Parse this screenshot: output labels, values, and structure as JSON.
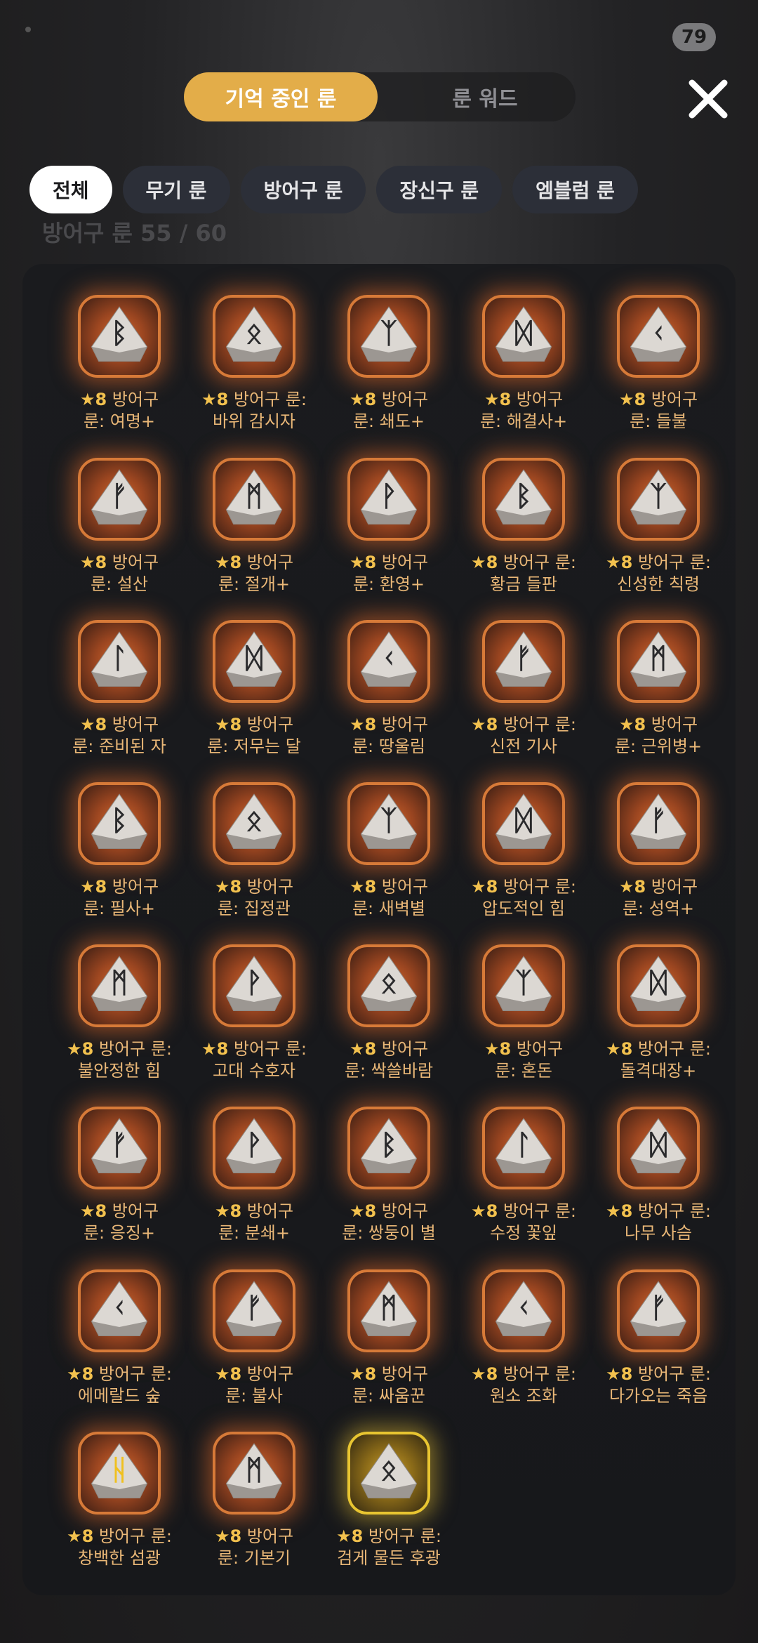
{
  "status": {
    "badge": "79"
  },
  "tabs": {
    "active": "기억 중인 룬",
    "inactive": "룬 워드"
  },
  "filters": [
    "전체",
    "무기 룬",
    "방어구 룬",
    "장신구 룬",
    "엠블럼 룬"
  ],
  "ghost_text": "방어구 룬 55 / 60",
  "star_prefix": "★8",
  "runes": [
    {
      "l1": "방어구",
      "l2": "룬: 여명+",
      "glyph": "ᛒ"
    },
    {
      "l1": "방어구 룬:",
      "l2": "바위 감시자",
      "glyph": "ᛟ"
    },
    {
      "l1": "방어구",
      "l2": "룬: 쇄도+",
      "glyph": "ᛉ"
    },
    {
      "l1": "방어구",
      "l2": "룬: 해결사+",
      "glyph": "ᛞ"
    },
    {
      "l1": "방어구",
      "l2": "룬: 들불",
      "glyph": "ᚲ"
    },
    {
      "l1": "방어구",
      "l2": "룬: 설산",
      "glyph": "ᚠ"
    },
    {
      "l1": "방어구",
      "l2": "룬: 절개+",
      "glyph": "ᛗ"
    },
    {
      "l1": "방어구",
      "l2": "룬: 환영+",
      "glyph": "ᚹ"
    },
    {
      "l1": "방어구 룬:",
      "l2": "황금 들판",
      "glyph": "ᛒ"
    },
    {
      "l1": "방어구 룬:",
      "l2": "신성한 칙령",
      "glyph": "ᛉ"
    },
    {
      "l1": "방어구",
      "l2": "룬: 준비된 자",
      "glyph": "ᛚ"
    },
    {
      "l1": "방어구",
      "l2": "룬: 저무는 달",
      "glyph": "ᛞ"
    },
    {
      "l1": "방어구",
      "l2": "룬: 땅울림",
      "glyph": "ᚲ"
    },
    {
      "l1": "방어구 룬:",
      "l2": "신전 기사",
      "glyph": "ᚠ"
    },
    {
      "l1": "방어구",
      "l2": "룬: 근위병+",
      "glyph": "ᛗ"
    },
    {
      "l1": "방어구",
      "l2": "룬: 필사+",
      "glyph": "ᛒ"
    },
    {
      "l1": "방어구",
      "l2": "룬: 집정관",
      "glyph": "ᛟ"
    },
    {
      "l1": "방어구",
      "l2": "룬: 새벽별",
      "glyph": "ᛉ"
    },
    {
      "l1": "방어구 룬:",
      "l2": "압도적인 힘",
      "glyph": "ᛞ"
    },
    {
      "l1": "방어구",
      "l2": "룬: 성역+",
      "glyph": "ᚠ"
    },
    {
      "l1": "방어구 룬:",
      "l2": "불안정한 힘",
      "glyph": "ᛗ"
    },
    {
      "l1": "방어구 룬:",
      "l2": "고대 수호자",
      "glyph": "ᚹ"
    },
    {
      "l1": "방어구",
      "l2": "룬: 싹쓸바람",
      "glyph": "ᛟ"
    },
    {
      "l1": "방어구",
      "l2": "룬: 혼돈",
      "glyph": "ᛉ"
    },
    {
      "l1": "방어구 룬:",
      "l2": "돌격대장+",
      "glyph": "ᛞ"
    },
    {
      "l1": "방어구",
      "l2": "룬: 응징+",
      "glyph": "ᚠ"
    },
    {
      "l1": "방어구",
      "l2": "룬: 분쇄+",
      "glyph": "ᚹ"
    },
    {
      "l1": "방어구",
      "l2": "룬: 쌍둥이 별",
      "glyph": "ᛒ"
    },
    {
      "l1": "방어구 룬:",
      "l2": "수정 꽃잎",
      "glyph": "ᛚ"
    },
    {
      "l1": "방어구 룬:",
      "l2": "나무 사슴",
      "glyph": "ᛞ"
    },
    {
      "l1": "방어구 룬:",
      "l2": "에메랄드 숲",
      "glyph": "ᚲ"
    },
    {
      "l1": "방어구",
      "l2": "룬: 불사",
      "glyph": "ᚠ"
    },
    {
      "l1": "방어구",
      "l2": "룬: 싸움꾼",
      "glyph": "ᛗ"
    },
    {
      "l1": "방어구 룬:",
      "l2": "원소 조화",
      "glyph": "ᚲ"
    },
    {
      "l1": "방어구 룬:",
      "l2": "다가오는 죽음",
      "glyph": "ᚠ"
    },
    {
      "l1": "방어구 룬:",
      "l2": "창백한 섬광",
      "glyph": "ᚺ",
      "gold_glyph": true
    },
    {
      "l1": "방어구",
      "l2": "룬: 기본기",
      "glyph": "ᛗ"
    },
    {
      "l1": "방어구 룬:",
      "l2": "검게 물든 후광",
      "glyph": "ᛟ",
      "gold_frame": true
    }
  ]
}
